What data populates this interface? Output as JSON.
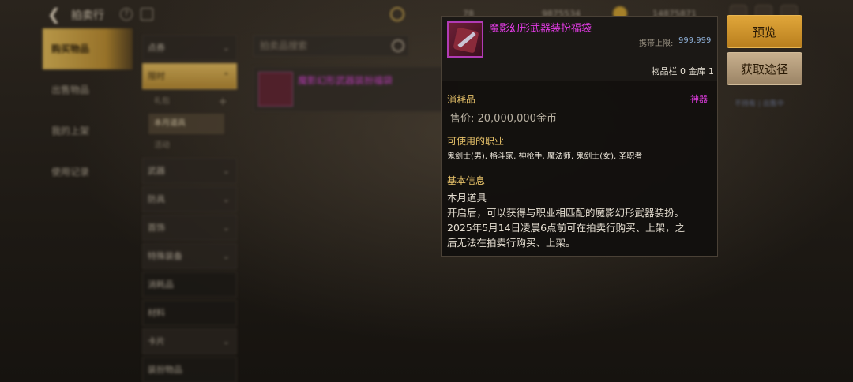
{
  "header": {
    "title": "拍卖行",
    "currency_1": "78",
    "currency_2": "9875534",
    "currency_3": "14875871"
  },
  "left_menu": {
    "items": [
      {
        "label": "购买物品"
      },
      {
        "label": "出售物品"
      },
      {
        "label": "我的上架"
      },
      {
        "label": "使用记录"
      }
    ]
  },
  "categories": {
    "top": "点券",
    "open": "限时",
    "subs": [
      "礼包",
      "本月道具",
      "活动"
    ],
    "rest": [
      "武器",
      "防具",
      "首饰",
      "特殊装备",
      "消耗品",
      "材料",
      "卡片",
      "装扮物品"
    ]
  },
  "search": {
    "placeholder": "拍卖品搜索"
  },
  "list": {
    "item_name": "魔影幻形武器装扮福袋",
    "right_note": "不持有 | 出售中"
  },
  "tooltip": {
    "name": "魔影幻形武器装扮福袋",
    "limit_label": "携带上限:",
    "limit_value": "999,999",
    "stock": "物品栏 0 金库 1",
    "type": "消耗品",
    "grade": "神器",
    "price": "售价: 20,000,000金币",
    "jobs_title": "可使用的职业",
    "jobs": "鬼剑士(男), 格斗家, 神枪手, 魔法师, 鬼剑士(女), 圣职者",
    "info_title": "基本信息",
    "desc_lines": [
      "本月道具",
      "开启后，可以获得与职业相匹配的魔影幻形武器装扮。",
      "2025年5月14日凌晨6点前可在拍卖行购买、上架，之",
      "后无法在拍卖行购买、上架。"
    ]
  },
  "buttons": {
    "preview": "预览",
    "source": "获取途径"
  },
  "colors": {
    "gold": "#e0a63a",
    "artifact_purple": "#e43be6",
    "section_gold": "#e8c36a"
  }
}
